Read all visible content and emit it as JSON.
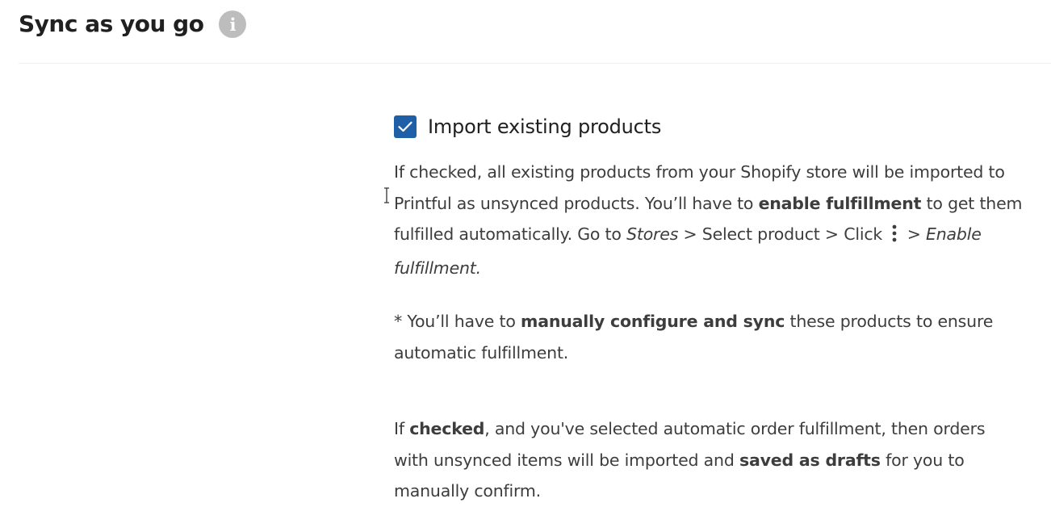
{
  "header": {
    "title": "Sync as you go",
    "info_icon": "info-icon"
  },
  "import_option": {
    "checked": true,
    "label": "Import existing products",
    "accent_color": "#1f5fa8"
  },
  "description": {
    "p1": {
      "a": "If checked, all existing products from your Shopify store will be imported to Printful as unsynced products. You’ll have to ",
      "b": "enable fulfillment",
      "c": " to get them fulfilled automatically. Go to ",
      "d": "Stores",
      "e": " > Select product > Click ",
      "f": " > ",
      "g": "Enable fulfillment.",
      "icon": "vertical-dots-icon"
    },
    "p2": {
      "a": "* You’ll have to ",
      "b": "manually configure and sync",
      "c": " these products to ensure automatic fulfillment."
    },
    "p3": {
      "a": "If ",
      "b": "checked",
      "c": ", and you've selected automatic order fulfillment, then orders with unsynced items will be imported and ",
      "d": "saved as drafts",
      "e": " for you to manually confirm."
    }
  }
}
